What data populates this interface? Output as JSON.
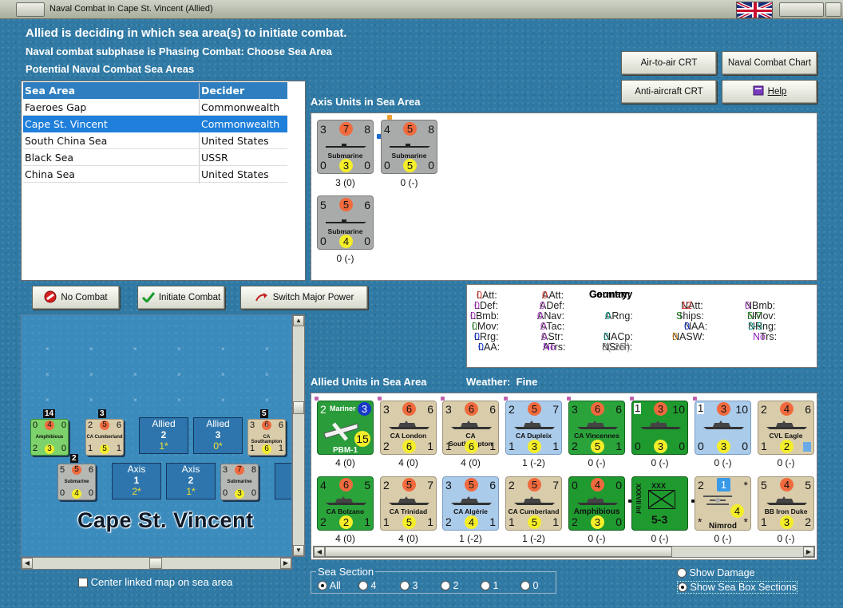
{
  "window": {
    "title": "Naval Combat In Cape St. Vincent (Allied)"
  },
  "header": {
    "line1": "Allied is deciding in which sea area(s) to initiate combat.",
    "line2": "Naval combat subphase is Phasing Combat: Choose Sea Area",
    "line3": "Potential Naval Combat Sea Areas"
  },
  "buttons": {
    "air_to_air": "Air-to-air CRT",
    "naval_chart": "Naval Combat Chart",
    "anti_aircraft": "Anti-aircraft CRT",
    "help": "Help",
    "no_combat": "No Combat",
    "initiate": "Initiate Combat",
    "switch": "Switch Major Power"
  },
  "sea_table": {
    "headers": [
      "Sea Area",
      "Decider"
    ],
    "rows": [
      {
        "area": "Faeroes Gap",
        "decider": "Commonwealth"
      },
      {
        "area": "Cape St. Vincent",
        "decider": "Commonwealth"
      },
      {
        "area": "South China Sea",
        "decider": "United States"
      },
      {
        "area": "Black Sea",
        "decider": "USSR"
      },
      {
        "area": "China Sea",
        "decider": "United States"
      }
    ],
    "selected_index": 1
  },
  "axis_panel": {
    "title": "Axis Units in Sea Area",
    "units": [
      {
        "tl": "3",
        "tc": "7",
        "tr": "8",
        "name": "Submarine",
        "bl": "0",
        "bc": "3",
        "br": "0",
        "cap": "3 (0)"
      },
      {
        "tl": "4",
        "tc": "5",
        "tr": "8",
        "name": "Submarine",
        "bl": "0",
        "bc": "5",
        "br": "0",
        "cap": "0 (-)"
      },
      {
        "tl": "5",
        "tc": "5",
        "tr": "6",
        "name": "Submarine",
        "bl": "0",
        "bc": "4",
        "br": "0",
        "cap": "0 (-)"
      }
    ]
  },
  "info_panel": {
    "country_label": "Country:",
    "country": "Germany",
    "col1": [
      {
        "k": "LAtt:",
        "v": "0"
      },
      {
        "k": "LDef:",
        "v": "0"
      },
      {
        "k": "LBmb:",
        "v": "0"
      },
      {
        "k": "LMov:",
        "v": "0"
      },
      {
        "k": "LRrg:",
        "v": "0"
      },
      {
        "k": "LAA:",
        "v": "0"
      }
    ],
    "col2": [
      {
        "k": "AAtt:",
        "v": "0"
      },
      {
        "k": "ADef:",
        "v": "0"
      },
      {
        "k": "ANav:",
        "v": "0"
      },
      {
        "k": "ATac:",
        "v": "0"
      },
      {
        "k": "AStr:",
        "v": "0"
      },
      {
        "k": "ATrs:",
        "v": "No"
      }
    ],
    "col3": [
      {
        "k": "ARng:",
        "v": "0"
      },
      {
        "k": "NACp:",
        "v": "0"
      },
      {
        "k": "NSrch:",
        "v": "3(-2R)"
      }
    ],
    "col4": [
      {
        "k": "NAtt:",
        "v": "12"
      },
      {
        "k": "Ships:",
        "v": "3"
      },
      {
        "k": "NAA:",
        "v": "0"
      },
      {
        "k": "NASW:",
        "v": "0"
      }
    ],
    "col5": [
      {
        "k": "NBmb:",
        "v": "0"
      },
      {
        "k": "NMov:",
        "v": "5-7"
      },
      {
        "k": "NRng:",
        "v": "3-5"
      },
      {
        "k": "NTrs:",
        "v": "No"
      }
    ]
  },
  "allied_panel": {
    "title": "Allied Units in Sea Area",
    "weather_label": "Weather:",
    "weather": "Fine",
    "row1": [
      {
        "tl": "2",
        "tc": "Mariner",
        "tr": "3",
        "name": "PBM-1",
        "bl": "",
        "bc": "15",
        "br": "",
        "cap": "4 (0)"
      },
      {
        "tl": "3",
        "tc": "6",
        "tr": "6",
        "name": "CA London",
        "bl": "2",
        "bc": "6",
        "br": "1",
        "cap": "4 (0)"
      },
      {
        "tl": "3",
        "tc": "6",
        "tr": "6",
        "name": "CA Southampton",
        "bl": "1",
        "bc": "6",
        "br": "1",
        "cap": "4 (0)"
      },
      {
        "tl": "2",
        "tc": "5",
        "tr": "7",
        "name": "CA Dupleix",
        "bl": "1",
        "bc": "3",
        "br": "1",
        "cap": "1 (-2)"
      },
      {
        "tl": "3",
        "tc": "6",
        "tr": "6",
        "name": "CA Vincennes",
        "bl": "2",
        "bc": "5",
        "br": "1",
        "cap": "0 (-)"
      },
      {
        "tl": "1",
        "tc": "3",
        "tr": "10",
        "name": "",
        "bl": "0",
        "bc": "3",
        "br": "0",
        "cap": "0 (-)"
      },
      {
        "tl": "1",
        "tc": "3",
        "tr": "10",
        "name": "",
        "bl": "0",
        "bc": "3",
        "br": "0",
        "cap": "0 (-)"
      },
      {
        "tl": "2",
        "tc": "4",
        "tr": "6",
        "name": "CVL Eagle",
        "bl": "1",
        "bc": "2",
        "br": "1",
        "cap": "0 (-)"
      }
    ],
    "row2": [
      {
        "tl": "4",
        "tc": "6",
        "tr": "5",
        "name": "CA Bolzano",
        "bl": "2",
        "bc": "2",
        "br": "1",
        "cap": "4 (0)"
      },
      {
        "tl": "2",
        "tc": "5",
        "tr": "7",
        "name": "CA Trinidad",
        "bl": "1",
        "bc": "5",
        "br": "1",
        "cap": "4 (0)"
      },
      {
        "tl": "3",
        "tc": "5",
        "tr": "6",
        "name": "CA Algérie",
        "bl": "2",
        "bc": "4",
        "br": "1",
        "cap": "1 (-2)"
      },
      {
        "tl": "2",
        "tc": "5",
        "tr": "7",
        "name": "CA Cumberland",
        "bl": "1",
        "bc": "5",
        "br": "1",
        "cap": "1 (-2)"
      },
      {
        "tl": "0",
        "tc": "4",
        "tr": "0",
        "name": "Amphibious",
        "bl": "2",
        "bc": "3",
        "br": "0",
        "cap": "0 (-)"
      },
      {
        "tl": "",
        "tc": "XXX",
        "tr": "",
        "name": "XXXVII Inf",
        "bl": "",
        "bc": "5-3",
        "br": "",
        "cap": "0 (-)"
      },
      {
        "tl": "2",
        "tc": "1",
        "tr": "*",
        "name": "Nimrod",
        "bl": "*",
        "bc": "4",
        "br": "*",
        "cap": "0 (-)"
      },
      {
        "tl": "5",
        "tc": "4",
        "tr": "5",
        "name": "BB Iron Duke",
        "bl": "1",
        "bc": "3",
        "br": "2",
        "cap": "0 (-)"
      }
    ]
  },
  "map": {
    "title": "Cape St. Vincent",
    "allied1": {
      "label": "Allied",
      "num": "2",
      "sub": "1*"
    },
    "allied2": {
      "label": "Allied",
      "num": "3",
      "sub": "0*"
    },
    "axis1": {
      "label": "Axis",
      "num": "1",
      "sub": "2*"
    },
    "axis2": {
      "label": "Axis",
      "num": "2",
      "sub": "1*"
    },
    "axis3": {
      "label": "A"
    },
    "counters": [
      {
        "name": "Amphibious",
        "stack": "14",
        "tl": "0",
        "tc": "4",
        "tr": "0",
        "bl": "2",
        "bc": "3",
        "br": "0"
      },
      {
        "name": "CA Cumberland",
        "stack": "3",
        "tl": "2",
        "tc": "5",
        "tr": "6",
        "bl": "1",
        "bc": "5",
        "br": "1"
      },
      {
        "name": "CA Southampton",
        "stack": "5",
        "tl": "3",
        "tc": "6",
        "tr": "6",
        "bl": "1",
        "bc": "6",
        "br": "1"
      },
      {
        "name": "Submarine",
        "stack": "2",
        "tl": "5",
        "tc": "5",
        "tr": "6",
        "bl": "0",
        "bc": "4",
        "br": "0"
      },
      {
        "name": "Submarine",
        "stack": "",
        "tl": "3",
        "tc": "7",
        "tr": "8",
        "bl": "0",
        "bc": "3",
        "br": "0"
      }
    ]
  },
  "options": {
    "center_map": "Center linked map on sea area",
    "sea_section": "Sea Section",
    "sections": [
      "All",
      "4",
      "3",
      "2",
      "1",
      "0"
    ],
    "show_damage": "Show Damage",
    "show_sections": "Show Sea Box Sections"
  },
  "colors": {
    "accent": "#1f7fdb",
    "sea": "#2f79a4",
    "attack": "#f06a3e",
    "defense": "#f4ee2a"
  }
}
